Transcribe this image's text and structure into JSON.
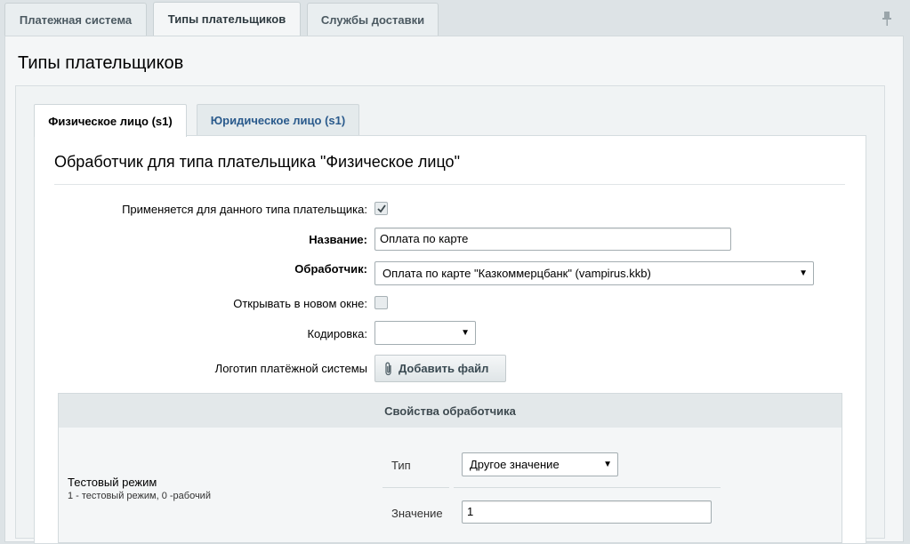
{
  "top_tabs": [
    {
      "label": "Платежная система",
      "active": false
    },
    {
      "label": "Типы плательщиков",
      "active": true
    },
    {
      "label": "Службы доставки",
      "active": false
    }
  ],
  "page_title": "Типы плательщиков",
  "payer_tabs": [
    {
      "label": "Физическое лицо (s1)",
      "active": true
    },
    {
      "label": "Юридическое лицо (s1)",
      "active": false
    }
  ],
  "section_title": "Обработчик для типа плательщика \"Физическое лицо\"",
  "form": {
    "applies_label": "Применяется для данного типа плательщика:",
    "applies_checked": true,
    "name_label": "Название:",
    "name_value": "Оплата по карте",
    "handler_label": "Обработчик:",
    "handler_value": "Оплата по карте \"Казкоммерцбанк\" (vampirus.kkb)",
    "new_window_label": "Открывать в новом окне:",
    "new_window_checked": false,
    "encoding_label": "Кодировка:",
    "encoding_value": "",
    "logo_label": "Логотип платёжной системы",
    "add_file_label": "Добавить файл"
  },
  "handler_props": {
    "header": "Свойства обработчика",
    "props": [
      {
        "title": "Тестовый режим",
        "description": "1 - тестовый режим, 0 -рабочий",
        "type_label": "Тип",
        "type_value": "Другое значение",
        "value_label": "Значение",
        "value": "1"
      }
    ]
  },
  "icons": {
    "pin": "pin-icon",
    "clip": "paperclip-icon",
    "check": "checkmark-icon",
    "dropdown": "dropdown-arrow-icon"
  }
}
